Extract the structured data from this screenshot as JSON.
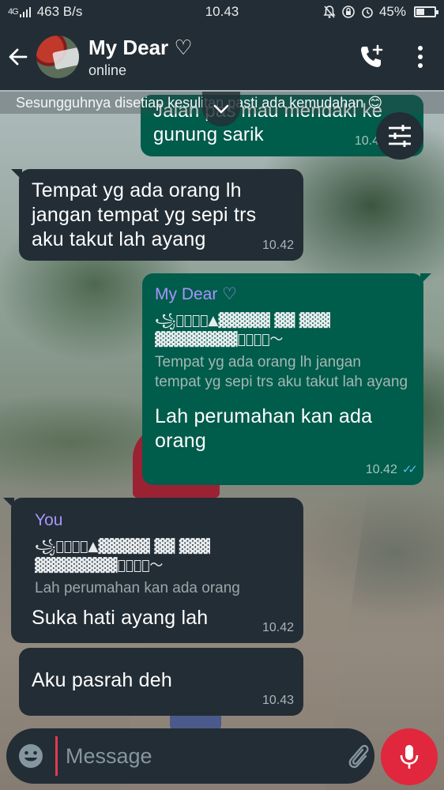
{
  "status_bar": {
    "signal": "4G",
    "network_speed": "463 B/s",
    "time": "10.43",
    "battery": "45%",
    "battery_level": 0.45
  },
  "header": {
    "back_icon": "arrow-left-icon",
    "contact_name": "My Dear ♡",
    "contact_status": "online",
    "call_icon": "add-call-icon",
    "menu_icon": "more-vert-icon"
  },
  "wallpaper_caption": "Sesungguhnya disetiap  kesulitan pasti ada kemudahan 😊",
  "messages": [
    {
      "direction": "out",
      "text": "Jalan pas mau mendaki ke\ngunung sarik",
      "time": "10.4"
    },
    {
      "direction": "in",
      "text": "Tempat yg ada orang lh\njangan tempat yg sepi trs\naku takut lah ayang",
      "time": "10.42"
    },
    {
      "direction": "out",
      "quote_name": "My Dear ♡",
      "quote_deco_1": "꧁⍟ꦿ𝐒ꦿ▲▓▓▓▓▓ ▓▓ ▓▓▓",
      "quote_deco_2": "▓▓▓▓▓▓▓▓ꦿ𝐒ꦿ⍨〜",
      "quote_text": "Tempat yg ada orang lh jangan tempat yg sepi trs aku takut lah ayang",
      "text": "Lah perumahan kan ada\norang",
      "time": "10.42"
    },
    {
      "direction": "in",
      "quote_name": "You",
      "quote_deco_1": "꧁⍟ꦿ𝐒ꦿ▲▓▓▓▓▓ ▓▓ ▓▓▓",
      "quote_deco_2": "▓▓▓▓▓▓▓▓ꦿ𝐒ꦿ⍨〜",
      "quote_text": "Lah perumahan kan ada orang",
      "text": "Suka hati ayang lah",
      "time": "10.42"
    },
    {
      "direction": "in",
      "text": "Aku pasrah deh",
      "time": "10.43"
    }
  ],
  "composer": {
    "placeholder": "Message",
    "emoji_icon": "emoji-icon",
    "attach_icon": "paperclip-icon",
    "camera_icon": "camera-icon",
    "mic_icon": "microphone-icon"
  },
  "colors": {
    "bar_bg": "#232d35",
    "incoming_bubble": "#232d35",
    "outgoing_bubble": "#005c4b",
    "quote_name": "#a795ff",
    "read_ticks": "#53bdeb",
    "mic_button": "#e0273d"
  }
}
